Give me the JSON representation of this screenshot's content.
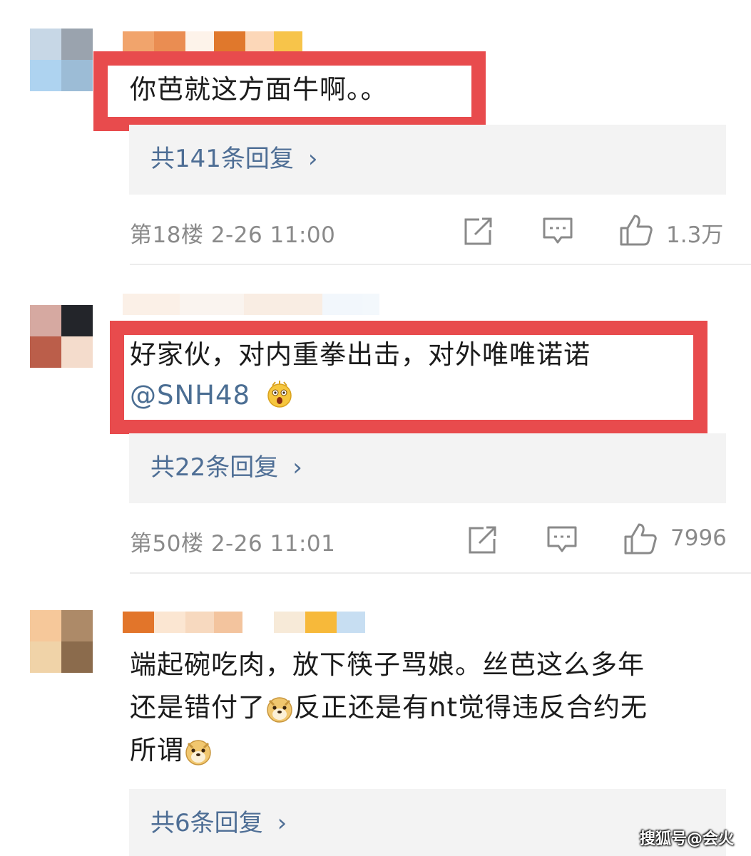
{
  "comments": [
    {
      "text": "你芭就这方面牛啊。。",
      "replies": "共141条回复",
      "floor": "第18楼",
      "time": "2-26 11:00",
      "likes": "1.3万"
    },
    {
      "text": "好家伙，对内重拳出击，对外唯唯诺诺",
      "mention": "@SNH48",
      "emoji": "shocked-face-emoji",
      "replies": "共22条回复",
      "floor": "第50楼",
      "time": "2-26 11:01",
      "likes": "7996"
    },
    {
      "text_line1": "端起碗吃肉，放下筷子骂娘。丝芭这么多年",
      "text_line2a": "还是错付了",
      "text_line2b": "反正还是有nt觉得违反合约无",
      "text_line3": "所谓",
      "emoji": "doge-emoji",
      "replies": "共6条回复"
    }
  ],
  "icons": {
    "share": "share-icon",
    "comment": "comment-icon",
    "like": "like-icon",
    "chevron": "chevron-right-icon"
  },
  "colors": {
    "highlight": "#e84b4d",
    "link": "#4e6e95",
    "meta": "#8a8a8a",
    "reply_bg": "#f3f3f3"
  },
  "watermark": "搜狐号@会火"
}
